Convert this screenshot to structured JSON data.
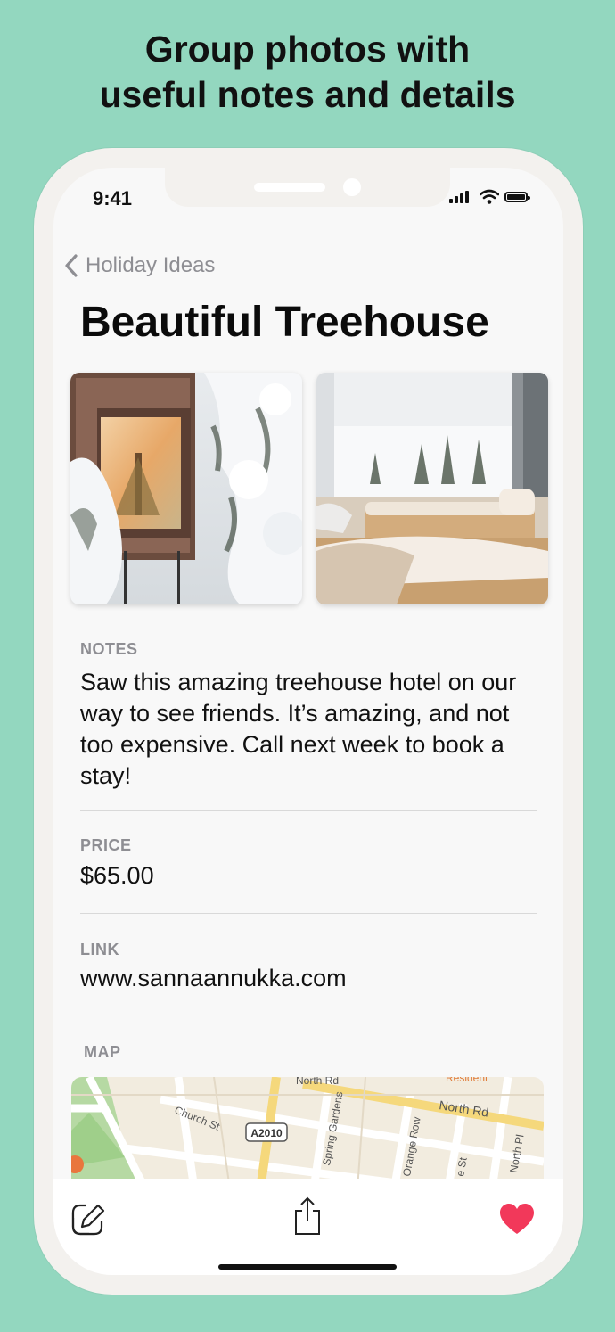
{
  "headline": {
    "line1": "Group photos with",
    "line2": "useful notes and details"
  },
  "status_bar": {
    "time": "9:41",
    "icons": [
      "signal-icon",
      "wifi-icon",
      "battery-icon"
    ]
  },
  "nav": {
    "back_label": "Holiday Ideas"
  },
  "item": {
    "title": "Beautiful Treehouse",
    "photos": [
      "treehouse-exterior-photo",
      "treehouse-bedroom-photo"
    ],
    "notes_label": "NOTES",
    "notes": "Saw this amazing treehouse hotel on our way to see friends. It’s amazing, and not too expensive. Call next week to book a stay!",
    "price_label": "PRICE",
    "price": "$65.00",
    "link_label": "LINK",
    "link": "www.sannaannukka.com",
    "map_label": "MAP",
    "map_labels": {
      "north_rd_top": "North Rd",
      "resident": "Resident",
      "north_rd": "North Rd",
      "church_st": "Church St",
      "a2010": "A2010",
      "spring_gardens": "Spring Gardens",
      "orange_row": "Orange Row",
      "north_pl": "North Pl",
      "e_st": "e St"
    }
  },
  "toolbar": {
    "edit": "edit-icon",
    "share": "share-icon",
    "favorite": "heart-icon"
  },
  "colors": {
    "background": "#93d7bf",
    "heart": "#f2385a",
    "secondary_text": "#8e8e93"
  }
}
